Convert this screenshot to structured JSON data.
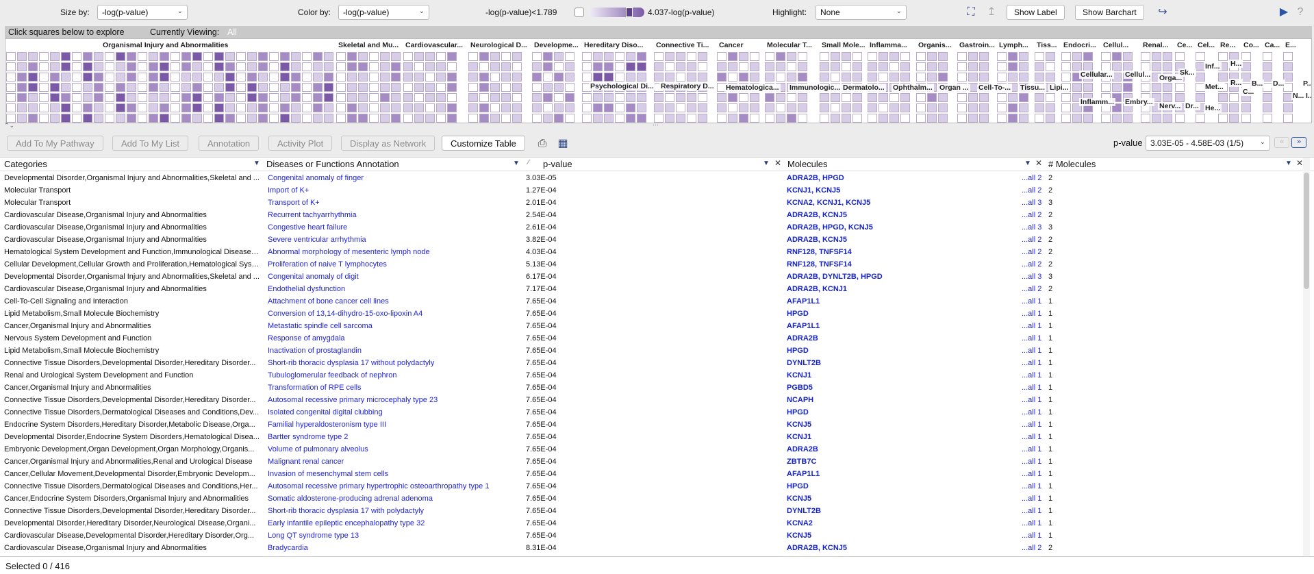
{
  "top_bar": {
    "size_by_label": "Size by:",
    "size_by_value": "-log(p-value)",
    "color_by_label": "Color by:",
    "color_by_value": "-log(p-value)",
    "range_low": "-log(p-value)<1.789",
    "range_high": "4.037-log(p-value)",
    "highlight_label": "Highlight:",
    "highlight_value": "None",
    "show_label_button": "Show Label",
    "show_barchart_button": "Show Barchart",
    "icons": [
      "expand-icon",
      "up-arrow-icon",
      "export-icon",
      "play-icon",
      "help-icon"
    ]
  },
  "explore_strip": {
    "hint": "Click squares below to explore",
    "currently_viewing_label": "Currently Viewing:",
    "currently_viewing_value": "All"
  },
  "treemap": {
    "colors": {
      "light": "#d8cde6",
      "mid": "#a58cc4",
      "dark": "#7a5aa6",
      "border": "#b9aac9"
    },
    "groups": [
      "Organismal Injury and Abnormalities",
      "Skeletal and Mu...",
      "Cardiovascular...",
      "Neurological D...",
      "Developme...",
      "Hereditary Diso...",
      "Connective Ti...",
      "Cancer",
      "Molecular T...",
      "Small Mole...",
      "Inflamma...",
      "Organis...",
      "Gastroin...",
      "Lymph...",
      "Tiss...",
      "Endocri...",
      "Cellul...",
      "Renal...",
      "Ce...",
      "Cel...",
      "Re...",
      "Co...",
      "Ca...",
      "E..."
    ],
    "sub_labels": [
      "Psychological Di...",
      "Respiratory D...",
      "Hematologica...",
      "Immunologic...",
      "Dermatolo...",
      "Ophthalm...",
      "Organ ...",
      "Cell-To-...",
      "Tissu...",
      "Lipi...",
      "Cellular...",
      "Cellul...",
      "Inflamm...",
      "Embry...",
      "Orga...",
      "Nerv...",
      "Dr...",
      "Sk...",
      "Inf...",
      "Met...",
      "He...",
      "H...",
      "R...",
      "B...",
      "D...",
      "C...",
      "N...",
      "P...",
      "I..."
    ]
  },
  "toolbar": {
    "add_pathway": "Add To My Pathway",
    "add_list": "Add To My List",
    "annotation": "Annotation",
    "activity_plot": "Activity Plot",
    "display_network": "Display as Network",
    "customize_table": "Customize Table",
    "pvalue_label": "p-value",
    "pvalue_range": "3.03E-05 - 4.58E-03 (1/5)"
  },
  "table": {
    "headers": [
      "Categories",
      "Diseases or Functions Annotation",
      "p-value",
      "Molecules",
      "# Molecules"
    ],
    "rows": [
      [
        "Developmental Disorder,Organismal Injury and Abnormalities,Skeletal and ...",
        "Congenital anomaly of finger",
        "3.03E-05",
        "ADRA2B, HPGD",
        "...all 2",
        "2"
      ],
      [
        "Molecular Transport",
        "Import of K+",
        "1.27E-04",
        "KCNJ1, KCNJ5",
        "...all 2",
        "2"
      ],
      [
        "Molecular Transport",
        "Transport of K+",
        "2.01E-04",
        "KCNA2, KCNJ1, KCNJ5",
        "...all 3",
        "3"
      ],
      [
        "Cardiovascular Disease,Organismal Injury and Abnormalities",
        "Recurrent tachyarrhythmia",
        "2.54E-04",
        "ADRA2B, KCNJ5",
        "...all 2",
        "2"
      ],
      [
        "Cardiovascular Disease,Organismal Injury and Abnormalities",
        "Congestive heart failure",
        "2.61E-04",
        "ADRA2B, HPGD, KCNJ5",
        "...all 3",
        "3"
      ],
      [
        "Cardiovascular Disease,Organismal Injury and Abnormalities",
        "Severe ventricular arrhythmia",
        "3.82E-04",
        "ADRA2B, KCNJ5",
        "...all 2",
        "2"
      ],
      [
        "Hematological System Development and Function,Immunological Disease,L...",
        "Abnormal morphology of mesenteric lymph node",
        "4.03E-04",
        "RNF128, TNFSF14",
        "...all 2",
        "2"
      ],
      [
        "Cellular Development,Cellular Growth and Proliferation,Hematological Syste...",
        "Proliferation of naive T lymphocytes",
        "5.13E-04",
        "RNF128, TNFSF14",
        "...all 2",
        "2"
      ],
      [
        "Developmental Disorder,Organismal Injury and Abnormalities,Skeletal and ...",
        "Congenital anomaly of digit",
        "6.17E-04",
        "ADRA2B, DYNLT2B, HPGD",
        "...all 3",
        "3"
      ],
      [
        "Cardiovascular Disease,Organismal Injury and Abnormalities",
        "Endothelial dysfunction",
        "7.17E-04",
        "ADRA2B, KCNJ1",
        "...all 2",
        "2"
      ],
      [
        "Cell-To-Cell Signaling and Interaction",
        "Attachment of bone cancer cell lines",
        "7.65E-04",
        "AFAP1L1",
        "...all 1",
        "1"
      ],
      [
        "Lipid Metabolism,Small Molecule Biochemistry",
        "Conversion of 13,14-dihydro-15-oxo-lipoxin A4",
        "7.65E-04",
        "HPGD",
        "...all 1",
        "1"
      ],
      [
        "Cancer,Organismal Injury and Abnormalities",
        "Metastatic spindle cell sarcoma",
        "7.65E-04",
        "AFAP1L1",
        "...all 1",
        "1"
      ],
      [
        "Nervous System Development and Function",
        "Response of amygdala",
        "7.65E-04",
        "ADRA2B",
        "...all 1",
        "1"
      ],
      [
        "Lipid Metabolism,Small Molecule Biochemistry",
        "Inactivation of prostaglandin",
        "7.65E-04",
        "HPGD",
        "...all 1",
        "1"
      ],
      [
        "Connective Tissue Disorders,Developmental Disorder,Hereditary Disorder...",
        "Short-rib thoracic dysplasia 17 without polydactyly",
        "7.65E-04",
        "DYNLT2B",
        "...all 1",
        "1"
      ],
      [
        "Renal and Urological System Development and Function",
        "Tubuloglomerular feedback of nephron",
        "7.65E-04",
        "KCNJ1",
        "...all 1",
        "1"
      ],
      [
        "Cancer,Organismal Injury and Abnormalities",
        "Transformation of RPE cells",
        "7.65E-04",
        "PGBD5",
        "...all 1",
        "1"
      ],
      [
        "Connective Tissue Disorders,Developmental Disorder,Hereditary Disorder...",
        "Autosomal recessive primary microcephaly type 23",
        "7.65E-04",
        "NCAPH",
        "...all 1",
        "1"
      ],
      [
        "Connective Tissue Disorders,Dermatological Diseases and Conditions,Dev...",
        "Isolated congenital digital clubbing",
        "7.65E-04",
        "HPGD",
        "...all 1",
        "1"
      ],
      [
        "Endocrine System Disorders,Hereditary Disorder,Metabolic Disease,Orga...",
        "Familial hyperaldosteronism type III",
        "7.65E-04",
        "KCNJ5",
        "...all 1",
        "1"
      ],
      [
        "Developmental Disorder,Endocrine System Disorders,Hematological Disea...",
        "Bartter syndrome type 2",
        "7.65E-04",
        "KCNJ1",
        "...all 1",
        "1"
      ],
      [
        "Embryonic Development,Organ Development,Organ Morphology,Organis...",
        "Volume of pulmonary alveolus",
        "7.65E-04",
        "ADRA2B",
        "...all 1",
        "1"
      ],
      [
        "Cancer,Organismal Injury and Abnormalities,Renal and Urological Disease",
        "Malignant renal cancer",
        "7.65E-04",
        "ZBTB7C",
        "...all 1",
        "1"
      ],
      [
        "Cancer,Cellular Movement,Developmental Disorder,Embryonic Developm...",
        "Invasion of mesenchymal stem cells",
        "7.65E-04",
        "AFAP1L1",
        "...all 1",
        "1"
      ],
      [
        "Connective Tissue Disorders,Dermatological Diseases and Conditions,Her...",
        "Autosomal recessive primary hypertrophic osteoarthropathy type 1",
        "7.65E-04",
        "HPGD",
        "...all 1",
        "1"
      ],
      [
        "Cancer,Endocrine System Disorders,Organismal Injury and Abnormalities",
        "Somatic aldosterone-producing adrenal adenoma",
        "7.65E-04",
        "KCNJ5",
        "...all 1",
        "1"
      ],
      [
        "Connective Tissue Disorders,Developmental Disorder,Hereditary Disorder...",
        "Short-rib thoracic dysplasia 17 with polydactyly",
        "7.65E-04",
        "DYNLT2B",
        "...all 1",
        "1"
      ],
      [
        "Developmental Disorder,Hereditary Disorder,Neurological Disease,Organi...",
        "Early infantile epileptic encephalopathy type 32",
        "7.65E-04",
        "KCNA2",
        "...all 1",
        "1"
      ],
      [
        "Cardiovascular Disease,Developmental Disorder,Hereditary Disorder,Org...",
        "Long QT syndrome type 13",
        "7.65E-04",
        "KCNJ5",
        "...all 1",
        "1"
      ],
      [
        "Cardiovascular Disease,Organismal Injury and Abnormalities",
        "Bradycardia",
        "8.31E-04",
        "ADRA2B, KCNJ5",
        "...all 2",
        "2"
      ]
    ]
  },
  "status": {
    "selected": "Selected 0 / 416"
  }
}
